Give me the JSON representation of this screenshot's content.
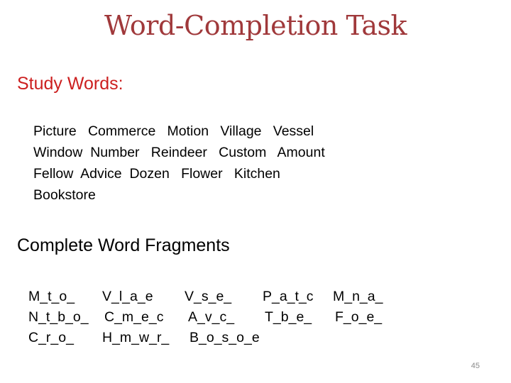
{
  "title": "Word-Completion Task",
  "study": {
    "heading": "Study Words:",
    "lines": [
      "Picture   Commerce   Motion   Village   Vessel",
      "Window  Number   Reindeer   Custom   Amount",
      "Fellow  Advice  Dozen   Flower   Kitchen",
      "Bookstore"
    ],
    "words": [
      "Picture",
      "Commerce",
      "Motion",
      "Village",
      "Vessel",
      "Window",
      "Number",
      "Reindeer",
      "Custom",
      "Amount",
      "Fellow",
      "Advice",
      "Dozen",
      "Flower",
      "Kitchen",
      "Bookstore"
    ]
  },
  "fragments": {
    "heading": "Complete Word Fragments",
    "rows": [
      [
        "M_t_o_",
        "V_l_a_e",
        "V_s_e_",
        "P_a_t_c",
        "M_n_a_"
      ],
      [
        "N_t_b_o_",
        "C_m_e_c",
        "A_v_c_",
        "T_b_e_",
        "F_o_e_"
      ],
      [
        "C_r_o_",
        "H_m_w_r_",
        "B_o_s_o_e"
      ]
    ]
  },
  "page_number": "45"
}
